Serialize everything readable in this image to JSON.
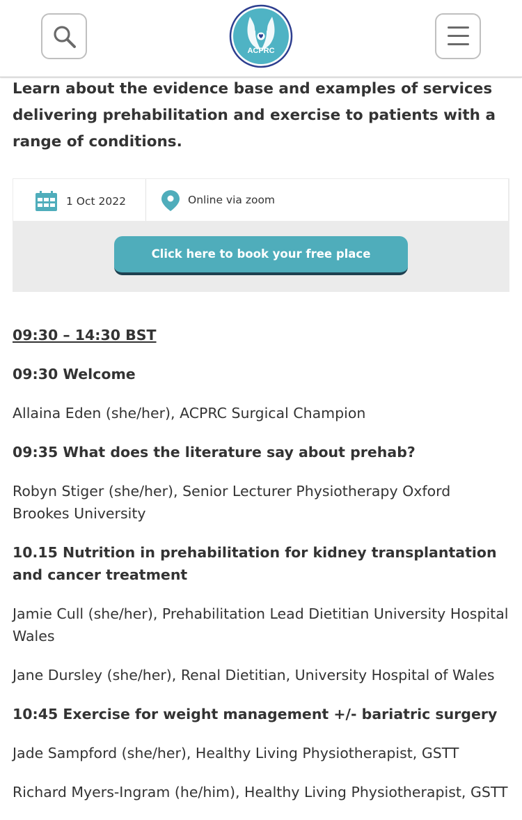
{
  "header": {
    "logo_text": "ACPRC",
    "search_icon": "search-icon",
    "menu_icon": "hamburger-menu-icon"
  },
  "intro": "Learn about the evidence base and examples of services delivering prehabilitation and exercise to patients with a range of conditions.",
  "event": {
    "date": "1 Oct 2022",
    "location": "Online via zoom",
    "book_button": "Click here to book your free place"
  },
  "agenda": {
    "time_range": "09:30 – 14:30 BST",
    "items": [
      {
        "title": "09:30 Welcome",
        "speakers": [
          "Allaina Eden (she/her), ACPRC Surgical Champion"
        ]
      },
      {
        "title": "09:35 What does the literature say about prehab?",
        "speakers": [
          "Robyn Stiger (she/her), Senior Lecturer Physiotherapy Oxford Brookes University"
        ]
      },
      {
        "title": "10.15 Nutrition in prehabilitation for kidney transplantation and cancer treatment",
        "speakers": [
          "Jamie Cull (she/her), Prehabilitation Lead Dietitian University Hospital Wales",
          "Jane Dursley (she/her), Renal Dietitian, University Hospital of Wales"
        ]
      },
      {
        "title": "10:45 Exercise for weight management +/- bariatric surgery",
        "speakers": [
          "Jade Sampford (she/her), Healthy Living Physiotherapist, GSTT",
          "Richard Myers-Ingram (he/him), Healthy Living Physiotherapist, GSTT"
        ]
      }
    ]
  },
  "colors": {
    "accent": "#4fadbb",
    "button_shadow": "#1e4050",
    "text": "#333333",
    "panel": "#ebebeb",
    "logo_ring": "#2d3e8f"
  }
}
